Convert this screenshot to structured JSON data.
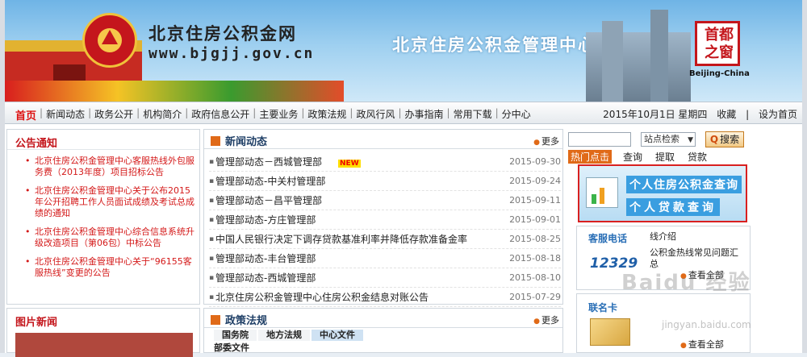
{
  "header": {
    "site_name": "北京住房公积金网",
    "site_url": "www.bjgjj.gov.cn",
    "banner_title": "北京住房公积金管理中心",
    "seal_text": "首都之窗",
    "seal_caption": "Beijing-China"
  },
  "nav": {
    "items": [
      "首页",
      "新闻动态",
      "政务公开",
      "机构简介",
      "政府信息公开",
      "主要业务",
      "政策法规",
      "政风行风",
      "办事指南",
      "常用下载",
      "分中心"
    ],
    "date": "2015年10月1日 星期四",
    "bookmark": "收藏",
    "set_home": "设为首页"
  },
  "notice": {
    "title": "公告通知",
    "items": [
      "北京住房公积金管理中心客服热线外包服务费（2013年度）项目招标公告",
      "北京住房公积金管理中心关于公布2015年公开招聘工作人员面试成绩及考试总成绩的通知",
      "北京住房公积金管理中心综合信息系统升级改造项目（第06包）中标公告",
      "北京住房公积金管理中心关于“96155客服热线”变更的公告"
    ]
  },
  "photo_news": {
    "title": "图片新闻"
  },
  "news": {
    "title": "新闻动态",
    "more": "更多",
    "new_badge": "NEW",
    "rows": [
      {
        "title": "管理部动态－西城管理部",
        "date": "2015-09-30"
      },
      {
        "title": "管理部动态-中关村管理部",
        "date": "2015-09-24"
      },
      {
        "title": "管理部动态－昌平管理部",
        "date": "2015-09-11"
      },
      {
        "title": "管理部动态-方庄管理部",
        "date": "2015-09-01"
      },
      {
        "title": "中国人民银行决定下调存贷款基准利率并降低存款准备金率",
        "date": "2015-08-25"
      },
      {
        "title": "管理部动态-丰台管理部",
        "date": "2015-08-18"
      },
      {
        "title": "管理部动态-西城管理部",
        "date": "2015-08-10"
      },
      {
        "title": "北京住房公积金管理中心住房公积金结息对账公告",
        "date": "2015-07-29"
      }
    ]
  },
  "policy": {
    "title": "政策法规",
    "more": "更多",
    "tabs": [
      "国务院",
      "地方法规",
      "中心文件"
    ],
    "sub": "部委文件"
  },
  "search": {
    "placeholder": "",
    "select_value": "站点检索",
    "button": "搜索"
  },
  "hot": {
    "label": "热门点击",
    "keywords": [
      "查询",
      "提取",
      "贷款"
    ]
  },
  "query": {
    "line1": "个人住房公积金查询",
    "line2": "个人贷款查询"
  },
  "service": {
    "title": "客服电话",
    "number": "12329",
    "item1": "线介绍",
    "item2": "公积金热线常见问题汇总",
    "more": "查看全部"
  },
  "card": {
    "title": "联名卡",
    "more": "查看全部"
  },
  "watermark": {
    "main": "Baidu 经验",
    "sub": "jingyan.baidu.com"
  }
}
